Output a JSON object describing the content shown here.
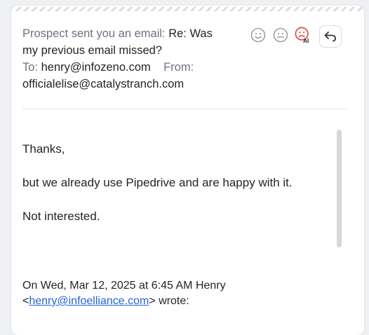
{
  "email": {
    "prefix": "Prospect sent you an email:",
    "subject": "Re: Was my previous email missed?",
    "to_label": "To:",
    "to_value": "henry@infozeno.com",
    "from_label": "From:",
    "from_value": "officialelise@catalystranch.com",
    "icons": [
      "happy-face-icon",
      "neutral-face-icon",
      "sad-face-ai-icon",
      "reply-icon"
    ],
    "ai_badge": "AI",
    "body": {
      "line1": "Thanks,",
      "line2": "but we already use Pipedrive and are happy with it.",
      "line3": "Not interested."
    },
    "quote": {
      "intro": "On Wed, Mar 12, 2025 at 6:45 AM Henry",
      "lt": "<",
      "email": "henry@infoelliance.com",
      "suffix": "> wrote:"
    },
    "colors": {
      "sad_ai": "#e04a3f",
      "link": "#2563d9"
    }
  }
}
